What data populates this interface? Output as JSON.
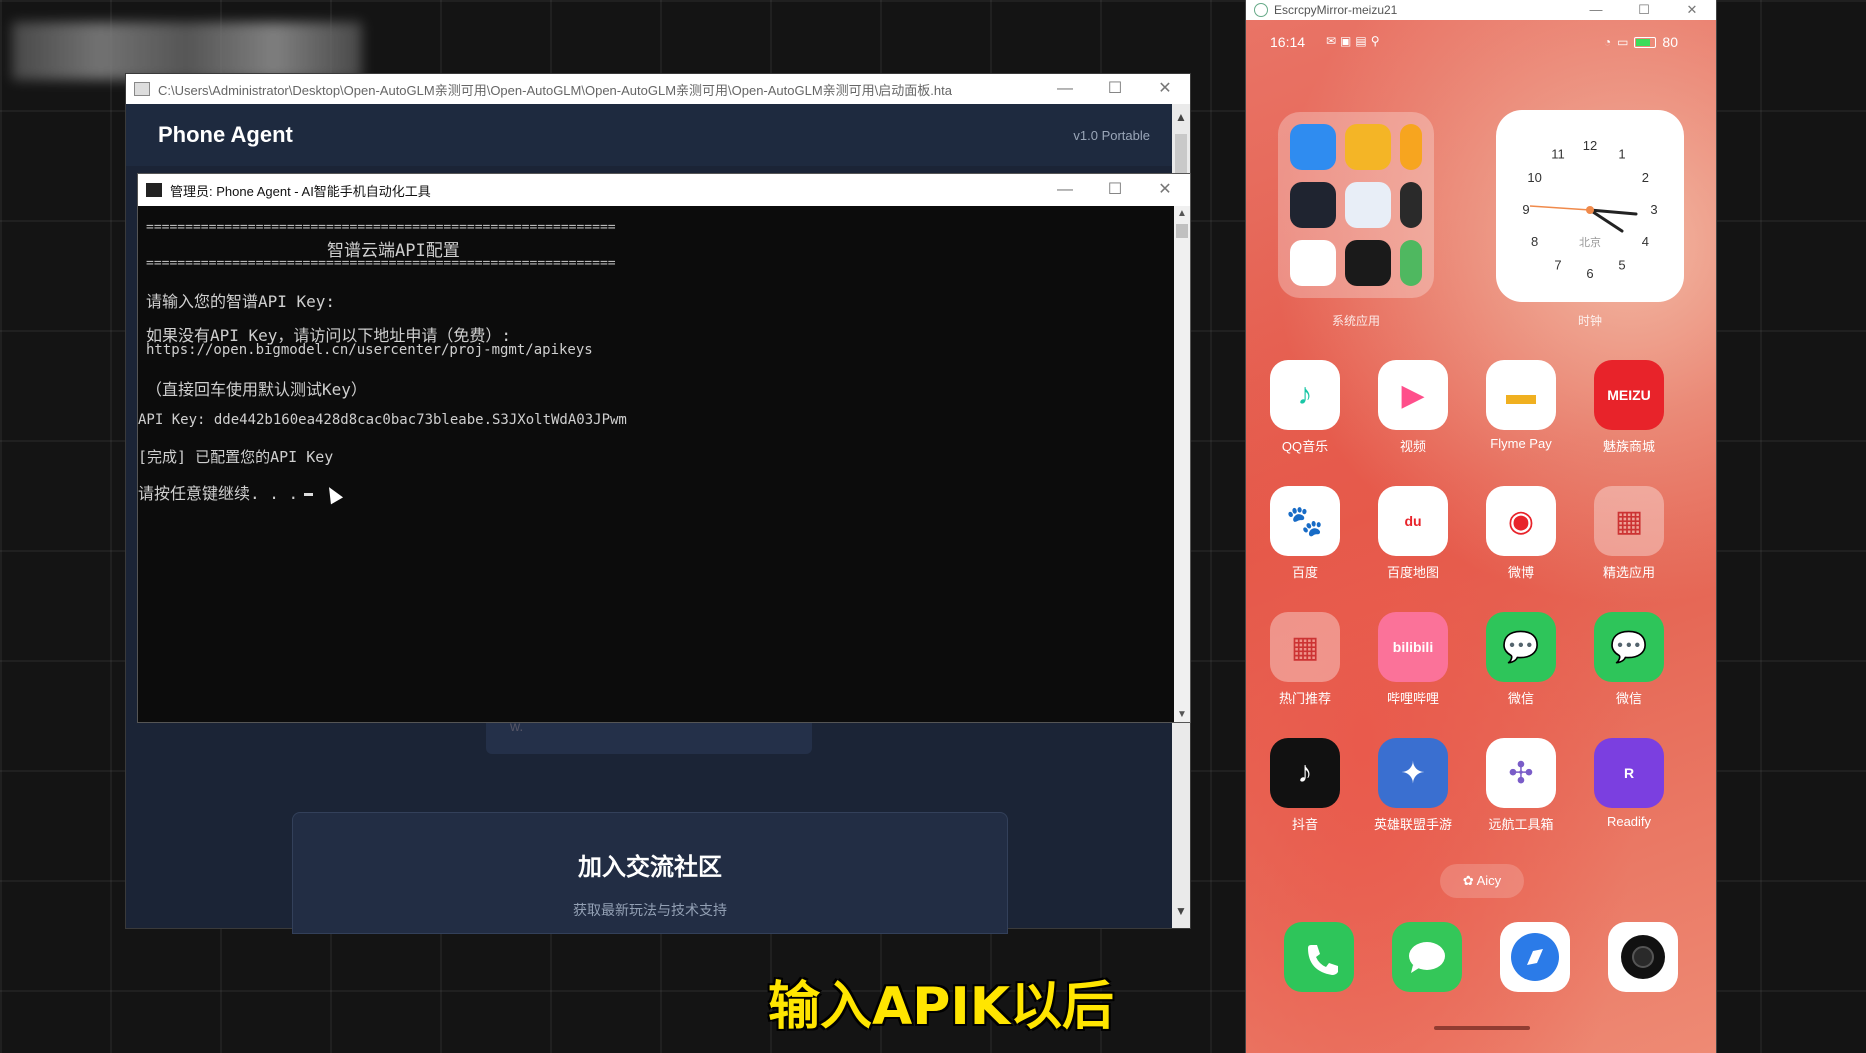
{
  "hta_window": {
    "title": "C:\\Users\\Administrator\\Desktop\\Open-AutoGLM亲测可用\\Open-AutoGLM\\Open-AutoGLM亲测可用\\Open-AutoGLM亲测可用\\启动面板.hta",
    "brand": "Phone Agent",
    "version": "v1.0 Portable",
    "small_card_text": "w.",
    "community_title": "加入交流社区",
    "community_subtitle": "获取最新玩法与技术支持"
  },
  "console": {
    "title": "管理员: Phone Agent - AI智能手机自动化工具",
    "separator": "============================================================",
    "heading": "智谱云端API配置",
    "prompt": "请输入您的智谱API Key:",
    "hint": "如果没有API Key，请访问以下地址申请（免费）:",
    "url": "https://open.bigmodel.cn/usercenter/proj-mgmt/apikeys",
    "default_hint": "（直接回车使用默认测试Key）",
    "api_key_line": "API Key: dde442b160ea428d8cac0bac73bleabe.S3JXoltWdA03JPwm",
    "done_line": "[完成] 已配置您的API Key",
    "continue_line": "请按任意键继续. . ."
  },
  "window_controls": {
    "minimize": "—",
    "maximize": "☐",
    "close": "✕"
  },
  "mirror": {
    "title": "EscrcpyMirror-meizu21",
    "status": {
      "time": "16:14",
      "battery": "80"
    },
    "folder_label": "系统应用",
    "clock_label": "时钟",
    "clock_city": "北京",
    "clock_numbers": [
      "12",
      "1",
      "2",
      "3",
      "4",
      "5",
      "6",
      "7",
      "8",
      "9",
      "10",
      "11"
    ],
    "apps": [
      {
        "label": "QQ音乐"
      },
      {
        "label": "视频"
      },
      {
        "label": "Flyme Pay"
      },
      {
        "label": "魅族商城"
      },
      {
        "label": "百度"
      },
      {
        "label": "百度地图"
      },
      {
        "label": "微博"
      },
      {
        "label": "精选应用"
      },
      {
        "label": "热门推荐"
      },
      {
        "label": "哔哩哔哩"
      },
      {
        "label": "微信"
      },
      {
        "label": "微信"
      },
      {
        "label": "抖音"
      },
      {
        "label": "英雄联盟手游"
      },
      {
        "label": "远航工具箱"
      },
      {
        "label": "Readify"
      }
    ],
    "aicy_label": "Aicy",
    "meizu_logo": "MEIZU",
    "baidu_icon_text": "du",
    "bilibili_icon_text": "bilibili",
    "readify_icon_text": "R"
  },
  "subtitle": "输入APIK以后",
  "colors": {
    "console_bg": "#0c0c0c",
    "hta_bg": "#1b2436",
    "subtitle": "#ffe500"
  }
}
